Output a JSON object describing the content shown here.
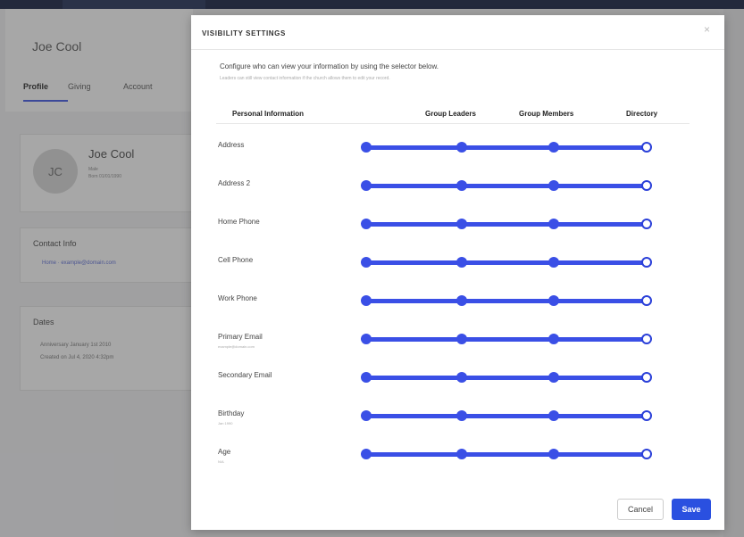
{
  "background": {
    "profile_name": "Joe Cool",
    "tabs": [
      "Profile",
      "Giving",
      "Account"
    ],
    "card_name": "Joe Cool",
    "avatar_initials": "JC",
    "card_sub1": "Male",
    "card_sub2": "Born 01/01/1990",
    "contact_title": "Contact Info",
    "contact_line": "Home · example@domain.com",
    "dates_title": "Dates",
    "dates_row1": "Anniversary   January 1st 2010",
    "dates_row2": "Created on    Jul 4, 2020 4:32pm"
  },
  "modal": {
    "title": "VISIBILITY SETTINGS",
    "close_icon": "×",
    "description": "Configure who can view your information by using the selector below.",
    "sub_description": "Leaders can still view contact information if the church allows them to edit your record.",
    "columns": {
      "personal": "Personal Information",
      "leaders": "Group Leaders",
      "members": "Group Members",
      "directory": "Directory"
    },
    "rows": [
      {
        "label": "Address",
        "sub": "",
        "level": "Directory"
      },
      {
        "label": "Address 2",
        "sub": "",
        "level": "Directory"
      },
      {
        "label": "Home Phone",
        "sub": "",
        "level": "Directory"
      },
      {
        "label": "Cell Phone",
        "sub": "",
        "level": "Directory"
      },
      {
        "label": "Work Phone",
        "sub": "",
        "level": "Directory"
      },
      {
        "label": "Primary Email",
        "sub": "example@domain.com",
        "level": "Directory"
      },
      {
        "label": "Secondary Email",
        "sub": "",
        "level": "Directory"
      },
      {
        "label": "Birthday",
        "sub": "Jan 1990",
        "level": "Directory"
      },
      {
        "label": "Age",
        "sub": "N/A",
        "level": "Directory"
      }
    ],
    "cancel_label": "Cancel",
    "save_label": "Save"
  },
  "colors": {
    "accent": "#3a4fe6",
    "save": "#2a50e0"
  }
}
